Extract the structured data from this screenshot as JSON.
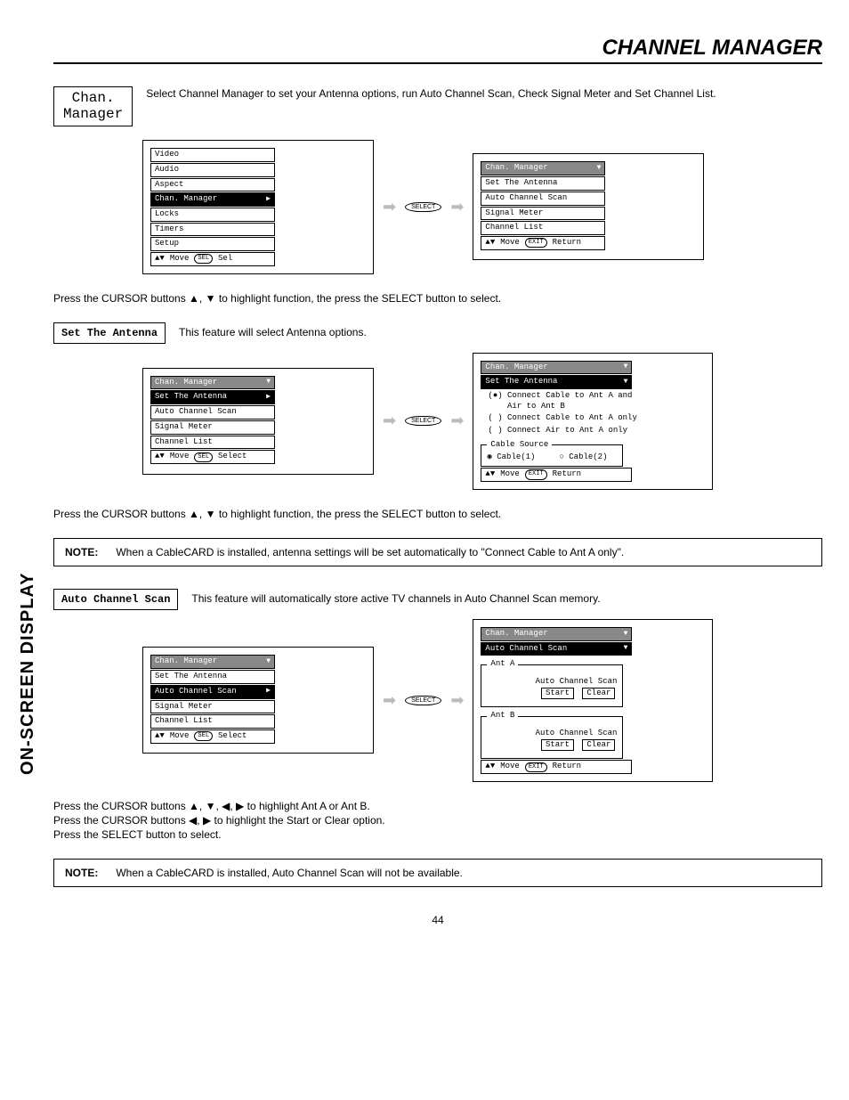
{
  "page": {
    "title": "CHANNEL MANAGER",
    "side_label": "ON-SCREEN DISPLAY",
    "number": "44"
  },
  "intro": {
    "box_label": "Chan.\nManager",
    "text": "Select Channel Manager to set your Antenna options, run Auto Channel Scan, Check Signal Meter and Set Channel List."
  },
  "screens1": {
    "left": {
      "items": [
        "Video",
        "Audio",
        "Aspect",
        "Chan. Manager",
        "Locks",
        "Timers",
        "Setup"
      ],
      "selected": "Chan. Manager",
      "hint_move": "Move",
      "hint_sel": "Sel",
      "sel_pill": "SEL"
    },
    "right": {
      "header": "Chan. Manager",
      "items": [
        "Set The Antenna",
        "Auto Channel Scan",
        "Signal Meter",
        "Channel List"
      ],
      "hint_move": "Move",
      "hint_ret": "Return",
      "sel_pill": "EXIT"
    },
    "select_label": "SELECT"
  },
  "body1": "Press the CURSOR buttons ▲, ▼ to highlight function, the press the SELECT button to select.",
  "section_antenna": {
    "label": "Set The Antenna",
    "text": "This feature will select Antenna options.",
    "screens": {
      "left": {
        "header": "Chan. Manager",
        "items": [
          "Set The Antenna",
          "Auto Channel Scan",
          "Signal Meter",
          "Channel List"
        ],
        "selected": "Set The Antenna",
        "hint_move": "Move",
        "hint_sel": "Select",
        "sel_pill": "SEL"
      },
      "right": {
        "header": "Chan. Manager",
        "sub": "Set The Antenna",
        "opt1": "(●) Connect Cable to Ant A and\n    Air to Ant B",
        "opt2": "( ) Connect Cable to Ant A only",
        "opt3": "( ) Connect Air to Ant A only",
        "cable_legend": "Cable Source",
        "cable1": "◉ Cable(1)",
        "cable2": "○ Cable(2)",
        "hint_move": "Move",
        "hint_ret": "Return",
        "sel_pill": "EXIT"
      },
      "select_label": "SELECT"
    },
    "body": "Press the CURSOR buttons ▲, ▼ to highlight function, the press the SELECT button to select.",
    "note_label": "NOTE:",
    "note_text": "When a CableCARD is installed, antenna settings will be set automatically to \"Connect Cable to Ant A only\"."
  },
  "section_autoscan": {
    "label": "Auto Channel Scan",
    "text": "This feature will automatically store active TV channels in Auto Channel Scan memory.",
    "screens": {
      "left": {
        "header": "Chan. Manager",
        "items": [
          "Set The Antenna",
          "Auto Channel Scan",
          "Signal Meter",
          "Channel List"
        ],
        "selected": "Auto Channel Scan",
        "hint_move": "Move",
        "hint_sel": "Select",
        "sel_pill": "SEL"
      },
      "right": {
        "header": "Chan. Manager",
        "sub": "Auto Channel Scan",
        "antA_legend": "Ant A",
        "antB_legend": "Ant B",
        "scan_label": "Auto Channel Scan",
        "start": "Start",
        "clear": "Clear",
        "hint_move": "Move",
        "hint_ret": "Return",
        "sel_pill": "EXIT"
      },
      "select_label": "SELECT"
    },
    "body1": "Press the CURSOR buttons ▲, ▼, ◀, ▶ to highlight Ant A or Ant B.",
    "body2": "Press the CURSOR buttons ◀, ▶ to highlight the Start or Clear option.",
    "body3": "Press the SELECT button to select.",
    "note_label": "NOTE:",
    "note_text": "When a CableCARD is installed, Auto Channel Scan will not be available."
  }
}
